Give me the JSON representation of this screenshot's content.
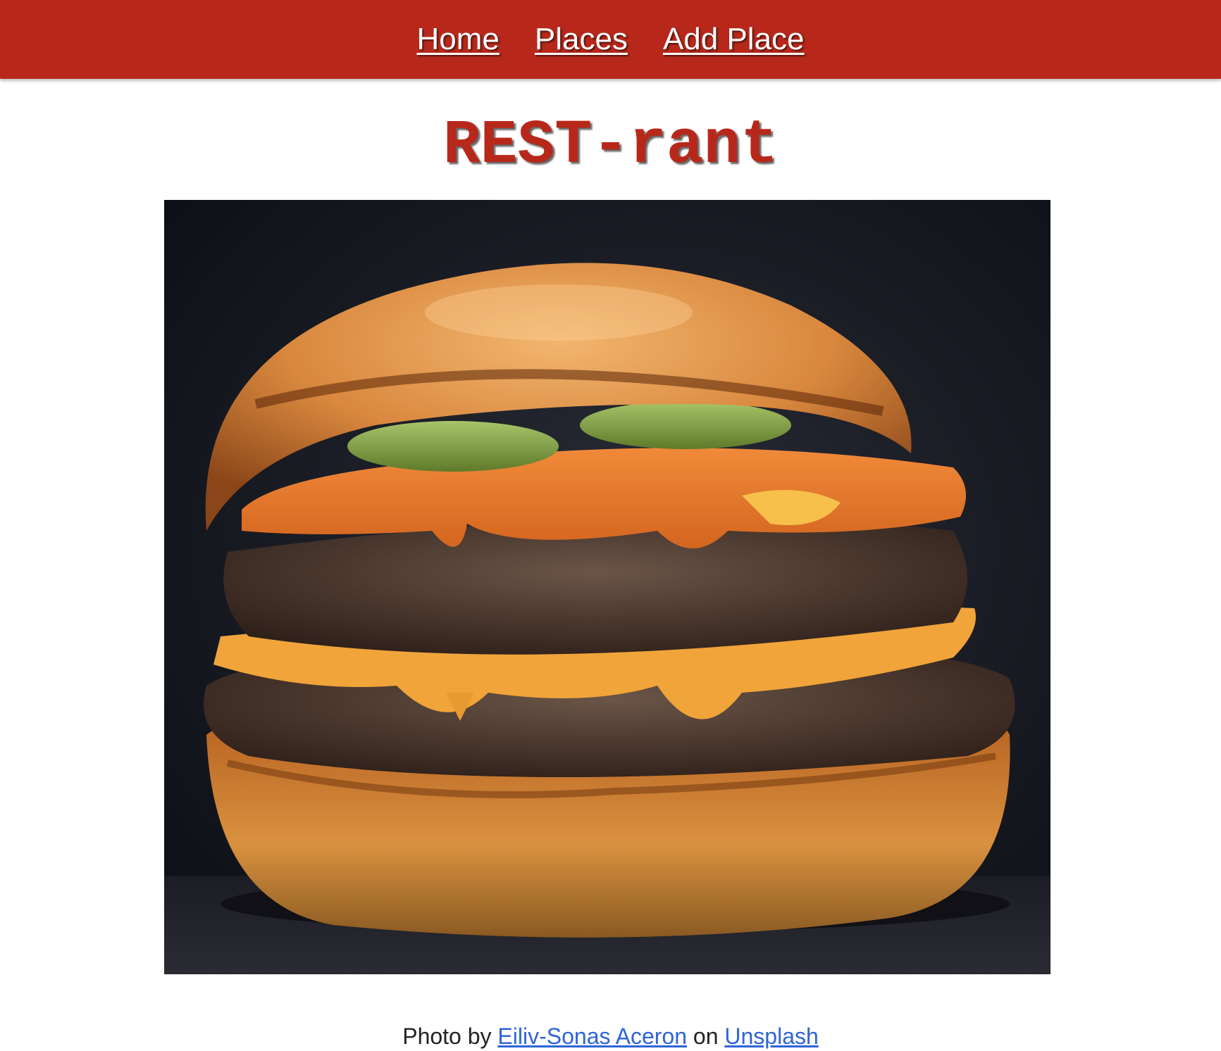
{
  "nav": {
    "items": [
      {
        "label": "Home"
      },
      {
        "label": "Places"
      },
      {
        "label": "Add Place"
      }
    ]
  },
  "page": {
    "title": "REST-rant"
  },
  "hero_image": {
    "subject": "double cheeseburger with pickles on a dark background"
  },
  "credit": {
    "prefix": "Photo by",
    "author": "Eiliv-Sonas Aceron",
    "middle": "on",
    "source": "Unsplash"
  },
  "colors": {
    "brand_red": "#b7281b",
    "link_blue": "#2f64d6"
  }
}
